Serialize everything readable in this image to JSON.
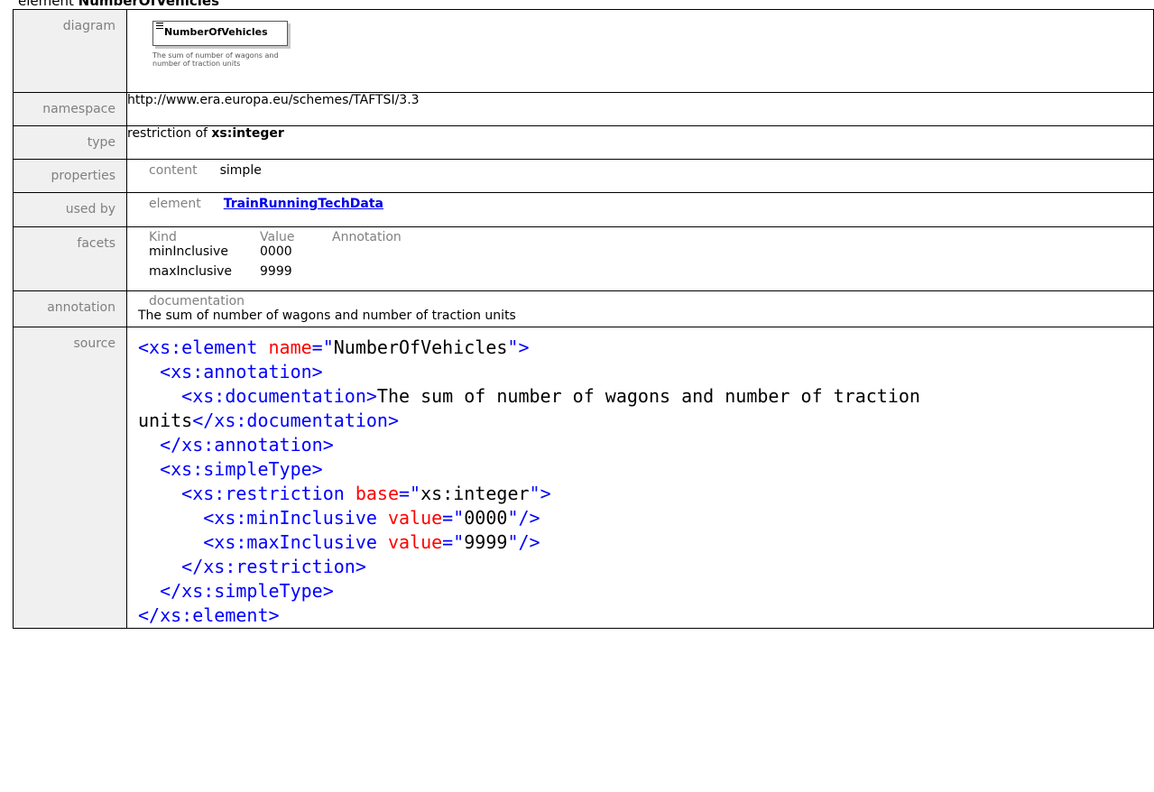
{
  "page": {
    "title_prefix": "element",
    "title_name": "NumberOfVehicles"
  },
  "labels": {
    "diagram": "diagram",
    "namespace": "namespace",
    "type": "type",
    "properties": "properties",
    "used_by": "used by",
    "facets": "facets",
    "annotation": "annotation",
    "source": "source"
  },
  "diagram": {
    "box_name": "NumberOfVehicles",
    "note": "The sum of number of wagons and number of traction units"
  },
  "namespace": "http://www.era.europa.eu/schemes/TAFTSI/3.3",
  "type": {
    "prefix": "restriction of",
    "base": "xs:integer"
  },
  "properties": {
    "key": "content",
    "value": "simple"
  },
  "used_by": {
    "key": "element",
    "link": "TrainRunningTechData"
  },
  "facets": {
    "headers": [
      "Kind",
      "Value",
      "Annotation"
    ],
    "rows": [
      {
        "kind": "minInclusive",
        "value": "0000"
      },
      {
        "kind": "maxInclusive",
        "value": "9999"
      }
    ]
  },
  "annotation": {
    "heading": "documentation",
    "text": "The sum of number of wagons and number of traction units"
  },
  "source": {
    "l1_open": "<xs:element",
    "l1_attr": "name",
    "l1_eq": "=\"",
    "l1_val": "NumberOfVehicles",
    "l1_close": "\">",
    "l2": "<xs:annotation>",
    "l3_open": "<xs:documentation>",
    "l3_text": "The sum of number of wagons and number of traction",
    "l4_text": "units",
    "l4_close": "</xs:documentation>",
    "l5": "</xs:annotation>",
    "l6": "<xs:simpleType>",
    "l7_open": "<xs:restriction",
    "l7_attr": "base",
    "l7_val": "xs:integer",
    "l8_open": "<xs:minInclusive",
    "l8_attr": "value",
    "l8_val": "0000",
    "l9_open": "<xs:maxInclusive",
    "l9_attr": "value",
    "l9_val": "9999",
    "self_close": "\"/>",
    "l10": "</xs:restriction>",
    "l11": "</xs:simpleType>",
    "l12": "</xs:element>"
  }
}
